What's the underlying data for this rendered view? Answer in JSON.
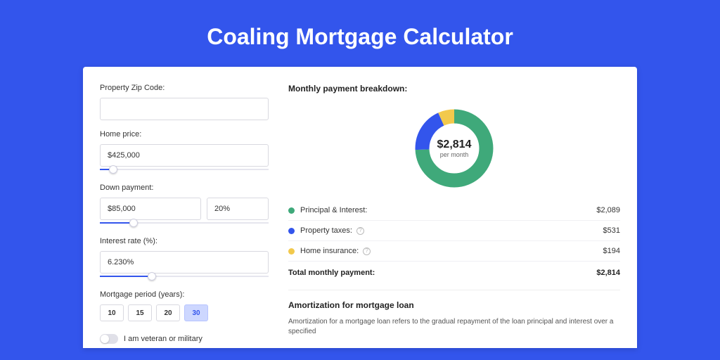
{
  "title": "Coaling Mortgage Calculator",
  "form": {
    "zip_label": "Property Zip Code:",
    "zip_value": "",
    "price_label": "Home price:",
    "price_value": "$425,000",
    "price_slider_pct": 8,
    "down_label": "Down payment:",
    "down_value": "$85,000",
    "down_pct_value": "20%",
    "down_slider_pct": 20,
    "rate_label": "Interest rate (%):",
    "rate_value": "6.230%",
    "rate_slider_pct": 31,
    "period_label": "Mortgage period (years):",
    "period_options": [
      "10",
      "15",
      "20",
      "30"
    ],
    "period_selected": "30",
    "veteran_label": "I am veteran or military"
  },
  "breakdown": {
    "title": "Monthly payment breakdown:",
    "center_amount": "$2,814",
    "center_sub": "per month",
    "pi_label": "Principal & Interest:",
    "pi_value": "$2,089",
    "tax_label": "Property taxes:",
    "tax_value": "$531",
    "ins_label": "Home insurance:",
    "ins_value": "$194",
    "total_label": "Total monthly payment:",
    "total_value": "$2,814"
  },
  "amort": {
    "title": "Amortization for mortgage loan",
    "body": "Amortization for a mortgage loan refers to the gradual repayment of the loan principal and interest over a specified"
  },
  "colors": {
    "pi": "#3fa97a",
    "tax": "#3355ec",
    "ins": "#f2c94c"
  },
  "chart_data": {
    "type": "pie",
    "series": [
      {
        "name": "Principal & Interest",
        "value": 2089,
        "color": "#3fa97a"
      },
      {
        "name": "Property taxes",
        "value": 531,
        "color": "#3355ec"
      },
      {
        "name": "Home insurance",
        "value": 194,
        "color": "#f2c94c"
      }
    ],
    "total": 2814,
    "title": "Monthly payment breakdown"
  }
}
